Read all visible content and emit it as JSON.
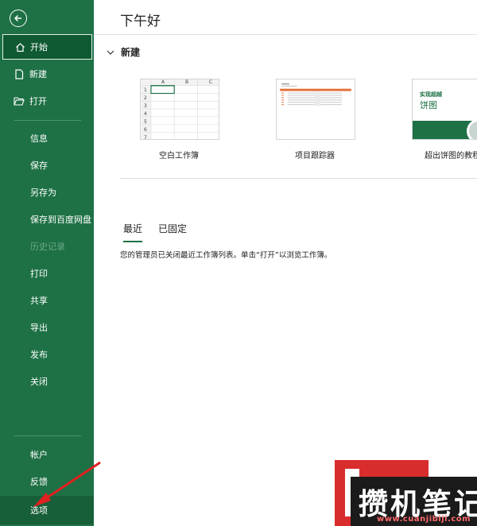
{
  "sidebar": {
    "back_icon": "back-arrow-icon",
    "items": [
      {
        "label": "开始",
        "icon": "home-icon",
        "selected": true
      },
      {
        "label": "新建",
        "icon": "new-file-icon"
      },
      {
        "label": "打开",
        "icon": "open-folder-icon"
      },
      {
        "label": "信息"
      },
      {
        "label": "保存"
      },
      {
        "label": "另存为"
      },
      {
        "label": "保存到百度网盘"
      },
      {
        "label": "历史记录",
        "disabled": true
      },
      {
        "label": "打印"
      },
      {
        "label": "共享"
      },
      {
        "label": "导出"
      },
      {
        "label": "发布"
      },
      {
        "label": "关闭"
      }
    ],
    "bottom_items": [
      {
        "label": "帐户"
      },
      {
        "label": "反馈"
      },
      {
        "label": "选项",
        "hover": true
      }
    ]
  },
  "main": {
    "greeting": "下午好",
    "new_section": {
      "title": "新建"
    },
    "templates": [
      {
        "caption": "空白工作簿",
        "columns": [
          "A",
          "B",
          "C"
        ],
        "rows": [
          "1",
          "2",
          "3",
          "4",
          "5",
          "6",
          "7"
        ]
      },
      {
        "caption": "项目跟踪器"
      },
      {
        "caption": "超出饼图的教程",
        "thumb_line1": "实现超越",
        "thumb_line2": "饼图"
      }
    ],
    "tabs": [
      {
        "label": "最近",
        "active": true
      },
      {
        "label": "已固定"
      }
    ],
    "notice": "您的管理员已关闭最近工作簿列表。单击“打开”以浏览工作簿。"
  },
  "watermark": {
    "title": "攒机笔记",
    "url": "www.cuanjibiji.com"
  },
  "colors": {
    "sidebar_bg": "#1e7145",
    "selected_bg": "#0f5a32",
    "accent": "#1e7145",
    "arrow": "#e02020"
  }
}
